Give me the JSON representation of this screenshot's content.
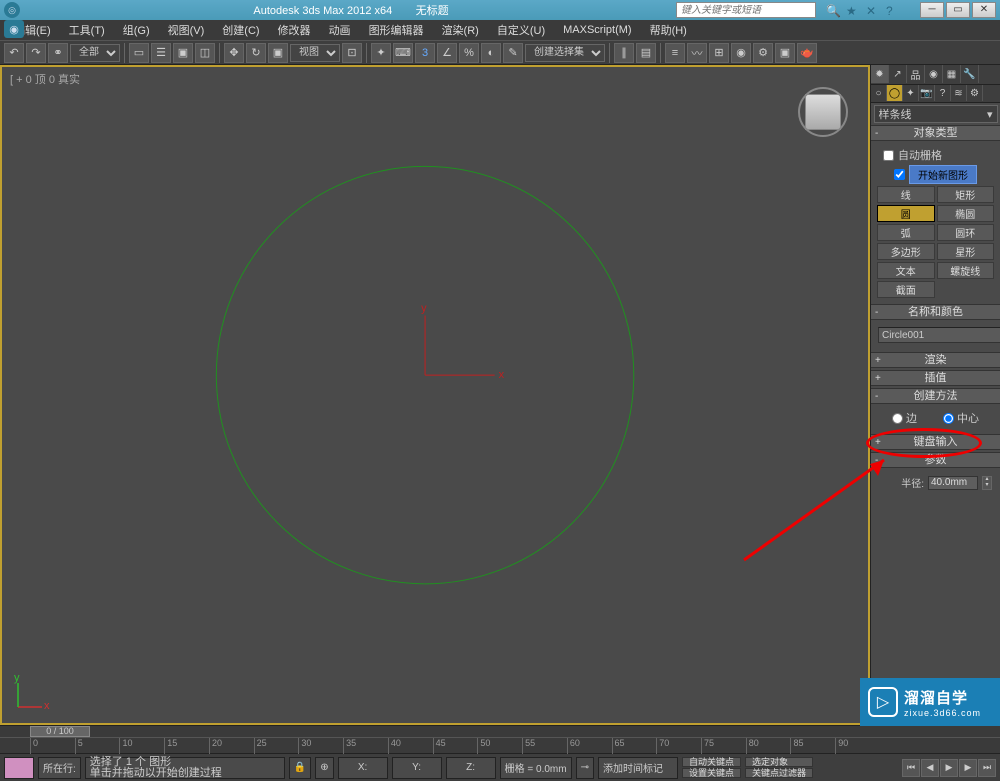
{
  "titlebar": {
    "app_title": "Autodesk 3ds Max 2012  x64",
    "doc_title": "无标题",
    "search_placeholder": "键入关键字或短语"
  },
  "menubar": [
    "编辑(E)",
    "工具(T)",
    "组(G)",
    "视图(V)",
    "创建(C)",
    "修改器",
    "动画",
    "图形编辑器",
    "渲染(R)",
    "自定义(U)",
    "MAXScript(M)",
    "帮助(H)"
  ],
  "toolbar": {
    "selset_label": "全部",
    "view_label": "视图",
    "named_sel": "创建选择集"
  },
  "viewport": {
    "label": "[ + 0 顶 0 真实"
  },
  "cmdpanel": {
    "dropdown": "样条线",
    "rollout_objtype": "对象类型",
    "auto_grid": "自动栅格",
    "start_new_shape": "开始新图形",
    "buttons": [
      {
        "label": "线",
        "active": false
      },
      {
        "label": "矩形",
        "active": false
      },
      {
        "label": "圆",
        "active": true
      },
      {
        "label": "椭圆",
        "active": false
      },
      {
        "label": "弧",
        "active": false
      },
      {
        "label": "圆环",
        "active": false
      },
      {
        "label": "多边形",
        "active": false
      },
      {
        "label": "星形",
        "active": false
      },
      {
        "label": "文本",
        "active": false
      },
      {
        "label": "螺旋线",
        "active": false
      },
      {
        "label": "截面",
        "active": false
      }
    ],
    "rollout_name": "名称和颜色",
    "obj_name": "Circle001",
    "rollout_render": "渲染",
    "rollout_interp": "插值",
    "rollout_create_method": "创建方法",
    "radio_edge": "边",
    "radio_center": "中心",
    "rollout_keyboard": "键盘输入",
    "rollout_params": "参数",
    "radius_label": "半径:",
    "radius_value": "40.0mm"
  },
  "timeline": {
    "slider_text": "0 / 100"
  },
  "statusbar": {
    "loc_label": "所在行:",
    "sel_line1": "选择了 1 个 图形",
    "sel_line2": "单击并拖动以开始创建过程",
    "x": "X:",
    "y": "Y:",
    "z": "Z:",
    "grid": "栅格 = 0.0mm",
    "add_tag": "添加时间标记",
    "autokey": "自动关键点",
    "setkey": "设置关键点",
    "sel_filter": "选定对象",
    "key_filter": "关键点过滤器"
  },
  "watermark": {
    "big": "溜溜自学",
    "small": "zixue.3d66.com"
  }
}
